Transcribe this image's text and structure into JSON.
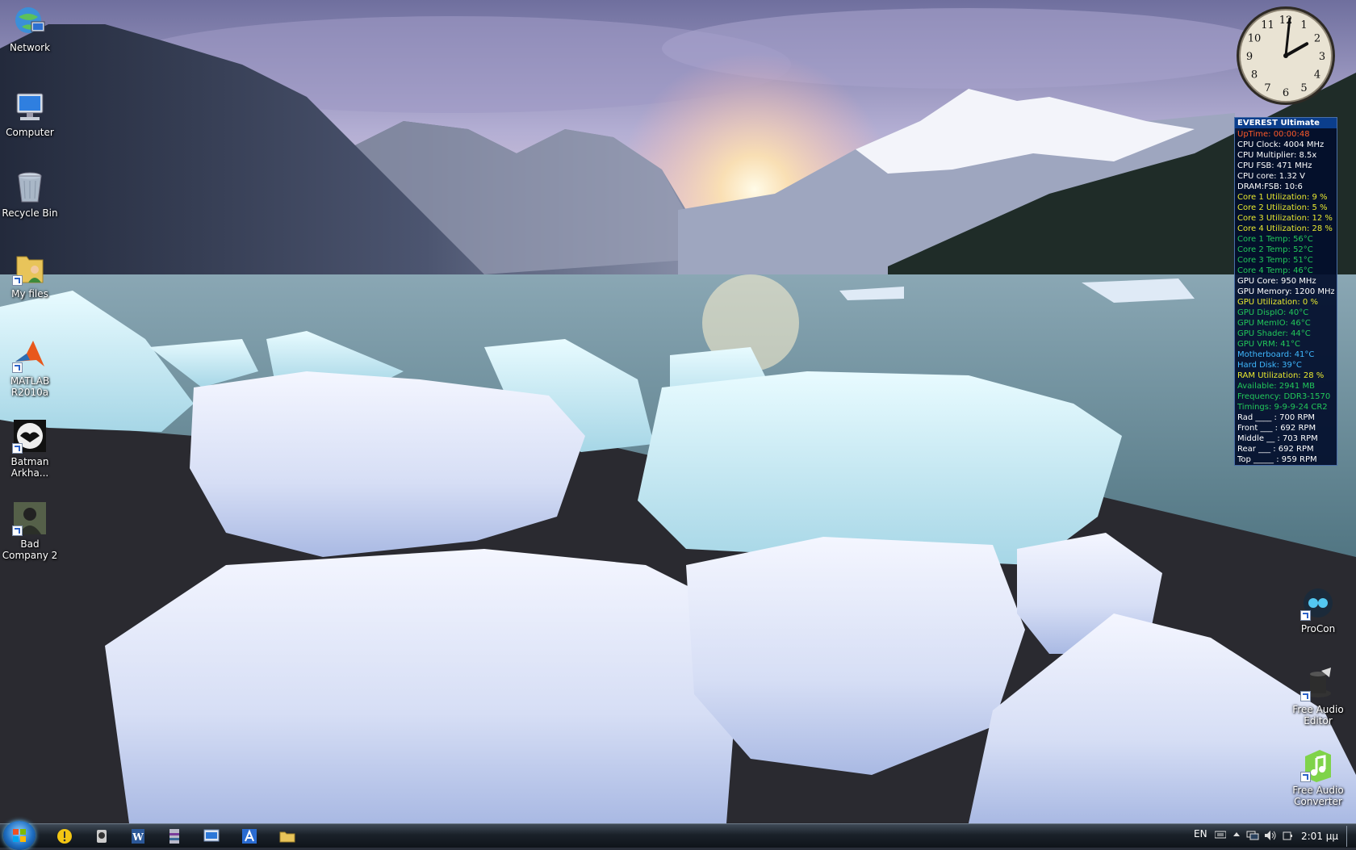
{
  "desktop": {
    "icons_left": [
      {
        "label": "Network",
        "icon": "network-globe-icon"
      },
      {
        "label": "Computer",
        "icon": "computer-icon"
      },
      {
        "label": "Recycle Bin",
        "icon": "recycle-bin-icon"
      },
      {
        "label": "My files",
        "icon": "folder-user-icon"
      },
      {
        "label": "MATLAB R2010a",
        "icon": "matlab-icon"
      },
      {
        "label": "Batman Arkha...",
        "icon": "batman-icon"
      },
      {
        "label": "Bad Company 2",
        "icon": "soldier-icon"
      }
    ],
    "icons_right": [
      {
        "label": "ProCon",
        "icon": "procon-icon"
      },
      {
        "label": "Free Audio Editor",
        "icon": "audio-editor-icon"
      },
      {
        "label": "Free Audio Converter",
        "icon": "audio-converter-icon"
      }
    ]
  },
  "clock": {
    "numbers": [
      "12",
      "1",
      "2",
      "3",
      "4",
      "5",
      "6",
      "7",
      "8",
      "9",
      "10",
      "11"
    ],
    "time": "2:01"
  },
  "everest": {
    "title": "EVEREST Ultimate",
    "rows": [
      {
        "text": "UpTime: 00:00:48",
        "color": "#ff5a2a"
      },
      {
        "text": "CPU Clock: 4004 MHz",
        "color": "#ffffff"
      },
      {
        "text": "CPU Multiplier: 8.5x",
        "color": "#ffffff"
      },
      {
        "text": "CPU FSB: 471 MHz",
        "color": "#ffffff"
      },
      {
        "text": "CPU core: 1.32 V",
        "color": "#ffffff"
      },
      {
        "text": "DRAM:FSB: 10:6",
        "color": "#ffffff"
      },
      {
        "text": "Core 1 Utilization: 9 %",
        "color": "#e8e830"
      },
      {
        "text": "Core 2 Utilization: 5 %",
        "color": "#e8e830"
      },
      {
        "text": "Core 3 Utilization: 12 %",
        "color": "#e8e830"
      },
      {
        "text": "Core 4 Utilization: 28 %",
        "color": "#e8e830"
      },
      {
        "text": "Core 1 Temp: 56°C",
        "color": "#22c85a"
      },
      {
        "text": "Core 2 Temp: 52°C",
        "color": "#22c85a"
      },
      {
        "text": "Core 3 Temp: 51°C",
        "color": "#22c85a"
      },
      {
        "text": "Core 4 Temp: 46°C",
        "color": "#22c85a"
      },
      {
        "text": "GPU Core: 950 MHz",
        "color": "#ffffff"
      },
      {
        "text": "GPU Memory: 1200 MHz",
        "color": "#ffffff"
      },
      {
        "text": "GPU Utilization: 0 %",
        "color": "#e8e830"
      },
      {
        "text": "GPU DispIO: 40°C",
        "color": "#22c85a"
      },
      {
        "text": "GPU MemIO: 46°C",
        "color": "#22c85a"
      },
      {
        "text": "GPU Shader: 44°C",
        "color": "#22c85a"
      },
      {
        "text": "GPU VRM: 41°C",
        "color": "#22c85a"
      },
      {
        "text": "Motherboard: 41°C",
        "color": "#3fb8ff"
      },
      {
        "text": "Hard Disk: 39°C",
        "color": "#3fb8ff"
      },
      {
        "text": "RAM Utilization: 28 %",
        "color": "#e8e830"
      },
      {
        "text": "Available: 2941 MB",
        "color": "#22c85a"
      },
      {
        "text": "Frequency: DDR3-1570",
        "color": "#22c85a"
      },
      {
        "text": "Timings: 9-9-9-24 CR2",
        "color": "#22c85a"
      },
      {
        "text": "Rad ____ : 700 RPM",
        "color": "#ffffff"
      },
      {
        "text": "Front ___ : 692 RPM",
        "color": "#ffffff"
      },
      {
        "text": "Middle __ : 703 RPM",
        "color": "#ffffff"
      },
      {
        "text": "Rear ___ : 692 RPM",
        "color": "#ffffff"
      },
      {
        "text": "Top _____ : 959 RPM",
        "color": "#ffffff"
      }
    ]
  },
  "taskbar": {
    "pinned": [
      "norton-icon",
      "webcam-icon",
      "word-icon",
      "winrar-icon",
      "task-manager-icon",
      "autocad-icon",
      "explorer-folder-icon"
    ],
    "tray": {
      "language": "EN",
      "time": "2:01 μμ"
    }
  }
}
